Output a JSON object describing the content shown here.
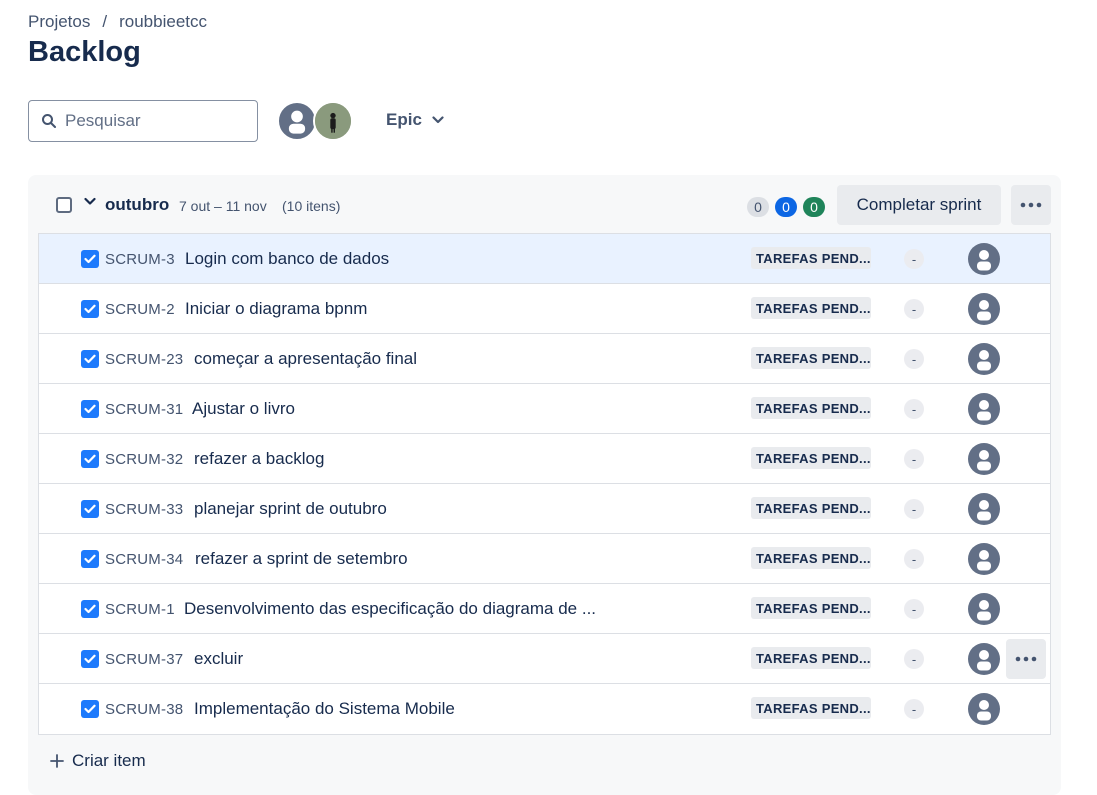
{
  "breadcrumb": {
    "projects": "Projetos",
    "separator": "/",
    "project": "roubbieetcc"
  },
  "page_title": "Backlog",
  "search": {
    "placeholder": "Pesquisar",
    "value": ""
  },
  "filter": {
    "epic_label": "Epic"
  },
  "sprint": {
    "name": "outubro",
    "dates": "7 out – 11 nov",
    "count": "(10 itens)",
    "badges": {
      "todo": "0",
      "in_progress": "0",
      "done": "0"
    },
    "complete_label": "Completar sprint"
  },
  "issues": [
    {
      "key": "SCRUM-3",
      "title": "Login com banco de dados",
      "status": "TAREFAS PEND...",
      "estimate": "-"
    },
    {
      "key": "SCRUM-2",
      "title": "Iniciar o diagrama bpnm",
      "status": "TAREFAS PEND...",
      "estimate": "-"
    },
    {
      "key": "SCRUM-23",
      "title": "começar a apresentação final",
      "status": "TAREFAS PEND...",
      "estimate": "-"
    },
    {
      "key": "SCRUM-31",
      "title": "Ajustar o livro",
      "status": "TAREFAS PEND...",
      "estimate": "-"
    },
    {
      "key": "SCRUM-32",
      "title": "refazer a backlog",
      "status": "TAREFAS PEND...",
      "estimate": "-"
    },
    {
      "key": "SCRUM-33",
      "title": "planejar sprint de outubro",
      "status": "TAREFAS PEND...",
      "estimate": "-"
    },
    {
      "key": "SCRUM-34",
      "title": "refazer a sprint de setembro",
      "status": "TAREFAS PEND...",
      "estimate": "-"
    },
    {
      "key": "SCRUM-1",
      "title": "Desenvolvimento das especificação do diagrama de ...",
      "status": "TAREFAS PEND...",
      "estimate": "-"
    },
    {
      "key": "SCRUM-37",
      "title": "excluir",
      "status": "TAREFAS PEND...",
      "estimate": "-"
    },
    {
      "key": "SCRUM-38",
      "title": "Implementação do Sistema Mobile",
      "status": "TAREFAS PEND...",
      "estimate": "-"
    }
  ],
  "create_item_label": "Criar item",
  "colors": {
    "accent": "#0c66e4",
    "done": "#1f845a",
    "checkbox": "#1d7afc",
    "selected_row": "#e9f2ff"
  }
}
